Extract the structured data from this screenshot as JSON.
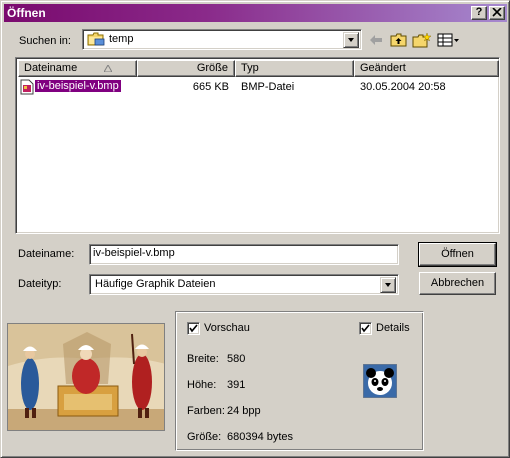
{
  "window": {
    "title": "Öffnen",
    "help_btn": "?",
    "close_btn": "×"
  },
  "look_in": {
    "label": "Suchen in:",
    "value": "temp"
  },
  "list": {
    "columns": [
      "Dateiname",
      "Größe",
      "Typ",
      "Geändert"
    ],
    "rows": [
      {
        "name": "iv-beispiel-v.bmp",
        "size": "665 KB",
        "type": "BMP-Datei",
        "modified": "30.05.2004 20:58",
        "selected": true
      }
    ]
  },
  "filename": {
    "label": "Dateiname:",
    "value": "iv-beispiel-v.bmp"
  },
  "filetype": {
    "label": "Dateityp:",
    "value": "Häufige Graphik Dateien"
  },
  "buttons": {
    "open": "Öffnen",
    "cancel": "Abbrechen"
  },
  "preview": {
    "show_preview_label": "Vorschau",
    "show_preview_checked": true,
    "details_label": "Details",
    "details_checked": true,
    "width_label": "Breite:",
    "width_value": "580",
    "height_label": "Höhe:",
    "height_value": "391",
    "colors_label": "Farben:",
    "colors_value": "24 bpp",
    "size_label": "Größe:",
    "size_value": "680394 bytes"
  },
  "icons": {
    "folder": "folder-icon",
    "back": "back-arrow-icon",
    "up": "up-folder-icon",
    "new_folder": "new-folder-icon",
    "view_menu": "view-menu-icon",
    "bmp_file": "bmp-file-icon",
    "app_logo": "panda-logo-icon"
  },
  "colors": {
    "title_gradient_start": "#7a0a6e",
    "title_gradient_end": "#a689cf",
    "selection": "#800080",
    "face": "#d4d0c8"
  }
}
